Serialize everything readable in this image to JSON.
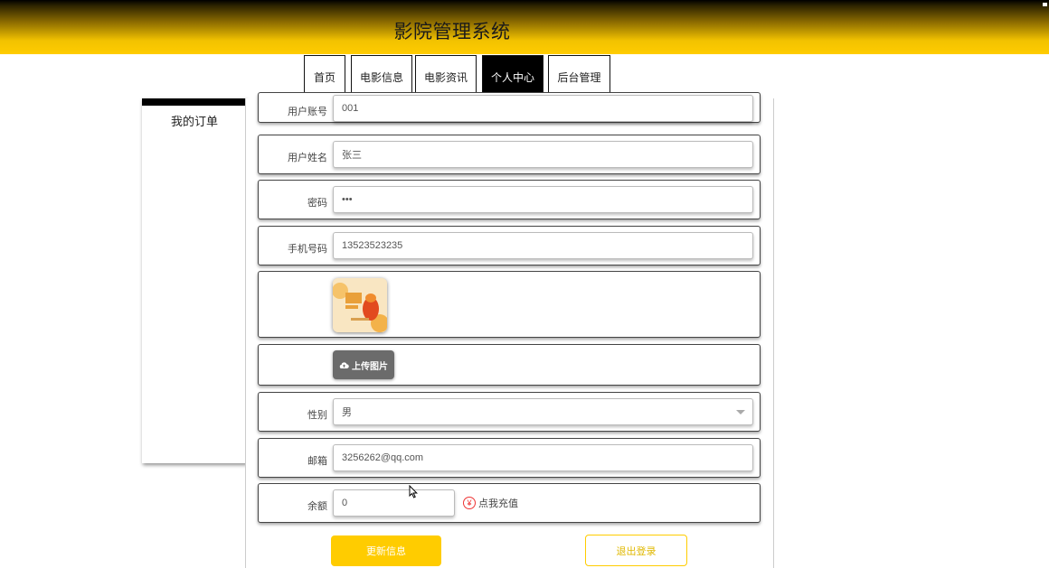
{
  "app": {
    "title": "影院管理系统"
  },
  "nav": {
    "items": [
      {
        "label": "首页"
      },
      {
        "label": "电影信息"
      },
      {
        "label": "电影资讯"
      },
      {
        "label": "个人中心"
      },
      {
        "label": "后台管理"
      }
    ],
    "active": "个人中心"
  },
  "sidebar": {
    "items": [
      {
        "label": "我的订单"
      }
    ]
  },
  "form": {
    "account": {
      "label": "用户账号",
      "value": "001"
    },
    "name": {
      "label": "用户姓名",
      "value": "张三"
    },
    "password": {
      "label": "密码",
      "value": "•••"
    },
    "phone": {
      "label": "手机号码",
      "value": "13523523235"
    },
    "upload_label": "上传图片",
    "gender": {
      "label": "性别",
      "value": "男"
    },
    "email": {
      "label": "邮箱",
      "value": "3256262@qq.com"
    },
    "balance": {
      "label": "余额",
      "value": "0",
      "recharge_label": "点我充值"
    },
    "update_button": "更新信息",
    "logout_button": "退出登录"
  },
  "icons": {
    "upload": "cloud-upload-icon",
    "recharge": "yen-icon",
    "select": "chevron-down-icon"
  },
  "colors": {
    "accent": "#ffcc00",
    "active_nav": "#000000"
  }
}
